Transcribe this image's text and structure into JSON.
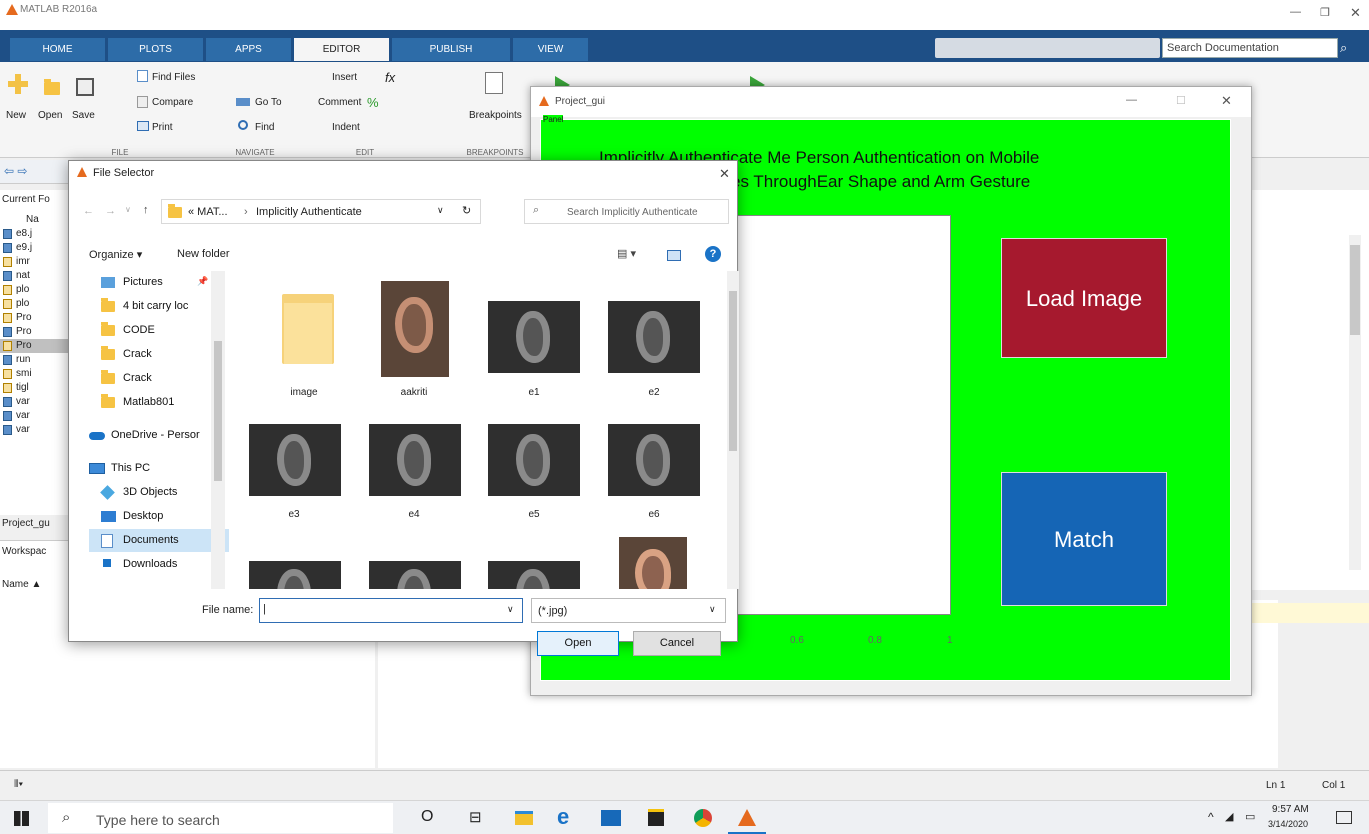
{
  "matlab": {
    "title": "MATLAB R2016a",
    "tabs": [
      "HOME",
      "PLOTS",
      "APPS",
      "EDITOR",
      "PUBLISH",
      "VIEW"
    ],
    "search_placeholder": "Search Documentation",
    "file_group": [
      "New",
      "Open",
      "Save"
    ],
    "find_files": "Find Files",
    "compare": "Compare",
    "print": "Print",
    "goto": "Go To",
    "find": "Find",
    "insert": "Insert",
    "comment": "Comment",
    "indent": "Indent",
    "breakpoints": "Breakpoints",
    "sections": [
      "FILE",
      "NAVIGATE",
      "EDIT",
      "BREAKPOINTS"
    ],
    "current_folder_label": "Current Fo",
    "name_col": "Na",
    "files": [
      "e8.j",
      "e9.j",
      "imr",
      "nat",
      "plo",
      "plo",
      "Pro",
      "Pro",
      "Pro",
      "run",
      "smi",
      "tigl",
      "var",
      "var",
      "var"
    ],
    "project_label": "Project_gu",
    "workspace_label": "Workspac",
    "ws_name_col": "Name ▲",
    "status_ln": "Ln  1",
    "status_col": "Col  1"
  },
  "gui": {
    "title": "Project_gui",
    "panel": "Panel",
    "heading_line1": "Implicitly Authenticate Me Person Authentication on Mobile",
    "heading_line2": "es ThroughEar Shape and Arm Gesture",
    "load_btn": "Load Image",
    "match_btn": "Match",
    "ticks": [
      "0.6",
      "0.8",
      "1"
    ],
    "colors": {
      "panel": "#00ff00",
      "load": "#a6192e",
      "match": "#1565b5"
    }
  },
  "dialog": {
    "title": "File Selector",
    "path_prefix": "« MAT...",
    "path_sep": "›",
    "path_current": "Implicitly Authenticate",
    "search_placeholder": "Search Implicitly Authenticate",
    "organize": "Organize ▾",
    "new_folder": "New folder",
    "nav": [
      "Pictures",
      "4 bit carry loc",
      "CODE",
      "Crack",
      "Crack",
      "Matlab801",
      "OneDrive - Persor",
      "This PC",
      "3D Objects",
      "Desktop",
      "Documents",
      "Downloads"
    ],
    "items": [
      "image",
      "aakriti",
      "e1",
      "e2",
      "e3",
      "e4",
      "e5",
      "e6"
    ],
    "file_name_label": "File name:",
    "file_type": "(*.jpg)",
    "open": "Open",
    "cancel": "Cancel"
  },
  "taskbar": {
    "search": "Type here to search",
    "time": "9:57 AM",
    "date": "3/14/2020"
  }
}
